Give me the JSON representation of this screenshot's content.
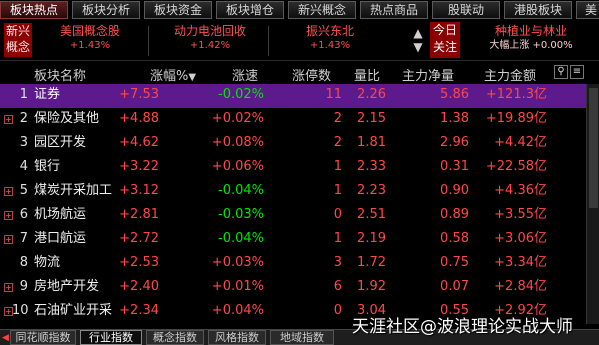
{
  "top_tabs": [
    {
      "label": "板块热点",
      "active": true
    },
    {
      "label": "板块分析",
      "active": false
    },
    {
      "label": "板块资金",
      "active": false
    },
    {
      "label": "板块增仓",
      "active": false
    },
    {
      "label": "新兴概念",
      "active": false
    },
    {
      "label": "热点商品",
      "active": false
    },
    {
      "label": "股联动",
      "active": false
    },
    {
      "label": "港股板块",
      "active": false
    },
    {
      "label": "美",
      "active": false
    }
  ],
  "concept": {
    "left_label": "新兴概念",
    "items": [
      {
        "name": "美国概念股",
        "change": "+1.43%"
      },
      {
        "name": "动力电池回收",
        "change": "+1.42%"
      },
      {
        "name": "振兴东北",
        "change": "+1.43%"
      }
    ],
    "today_label": "今日关注",
    "today_item": {
      "name": "种植业与林业",
      "change": "大幅上涨  +0.00%"
    }
  },
  "header": {
    "name": "板块名称",
    "pct": "涨幅%",
    "spd": "涨速",
    "lim": "涨停数",
    "ratio": "量比",
    "net": "主力净量",
    "amt": "主力金额"
  },
  "rows": [
    {
      "rank": "1",
      "name": "证券",
      "pct": "+7.53",
      "spd": "-0.02%",
      "spd_color": "green",
      "lim": "11",
      "ratio": "2.26",
      "net": "5.86",
      "amt": "+121.3亿",
      "selected": true,
      "expand": false
    },
    {
      "rank": "2",
      "name": "保险及其他",
      "pct": "+4.88",
      "spd": "+0.02%",
      "spd_color": "red",
      "lim": "2",
      "ratio": "2.15",
      "net": "1.38",
      "amt": "+19.89亿",
      "selected": false,
      "expand": true
    },
    {
      "rank": "3",
      "name": "园区开发",
      "pct": "+4.62",
      "spd": "+0.08%",
      "spd_color": "red",
      "lim": "2",
      "ratio": "1.81",
      "net": "2.96",
      "amt": "+4.42亿",
      "selected": false,
      "expand": false
    },
    {
      "rank": "4",
      "name": "银行",
      "pct": "+3.22",
      "spd": "+0.06%",
      "spd_color": "red",
      "lim": "1",
      "ratio": "2.33",
      "net": "0.31",
      "amt": "+22.58亿",
      "selected": false,
      "expand": false
    },
    {
      "rank": "5",
      "name": "煤炭开采加工",
      "pct": "+3.12",
      "spd": "-0.04%",
      "spd_color": "green",
      "lim": "1",
      "ratio": "2.23",
      "net": "0.90",
      "amt": "+4.36亿",
      "selected": false,
      "expand": true
    },
    {
      "rank": "6",
      "name": "机场航运",
      "pct": "+2.81",
      "spd": "-0.03%",
      "spd_color": "green",
      "lim": "0",
      "ratio": "2.51",
      "net": "0.89",
      "amt": "+3.55亿",
      "selected": false,
      "expand": true
    },
    {
      "rank": "7",
      "name": "港口航运",
      "pct": "+2.72",
      "spd": "-0.04%",
      "spd_color": "green",
      "lim": "1",
      "ratio": "2.19",
      "net": "0.58",
      "amt": "+3.06亿",
      "selected": false,
      "expand": true
    },
    {
      "rank": "8",
      "name": "物流",
      "pct": "+2.53",
      "spd": "+0.03%",
      "spd_color": "red",
      "lim": "3",
      "ratio": "1.72",
      "net": "0.75",
      "amt": "+3.34亿",
      "selected": false,
      "expand": false
    },
    {
      "rank": "9",
      "name": "房地产开发",
      "pct": "+2.40",
      "spd": "+0.01%",
      "spd_color": "red",
      "lim": "6",
      "ratio": "1.92",
      "net": "0.07",
      "amt": "+2.84亿",
      "selected": false,
      "expand": true
    },
    {
      "rank": "10",
      "name": "石油矿业开采",
      "pct": "+2.34",
      "spd": "+0.04%",
      "spd_color": "red",
      "lim": "0",
      "ratio": "3.04",
      "net": "0.55",
      "amt": "+2.92亿",
      "selected": false,
      "expand": true
    }
  ],
  "bottom_tabs": [
    {
      "label": "同花顺指数",
      "active": false
    },
    {
      "label": "行业指数",
      "active": true
    },
    {
      "label": "概念指数",
      "active": false
    },
    {
      "label": "风格指数",
      "active": false
    },
    {
      "label": "地域指数",
      "active": false
    }
  ],
  "watermark": "天涯社区@波浪理论实战大师",
  "colors": {
    "up": "#ff4848",
    "down": "#00e600",
    "selected_row": "#5c1a8c",
    "accent": "#8b0000"
  }
}
